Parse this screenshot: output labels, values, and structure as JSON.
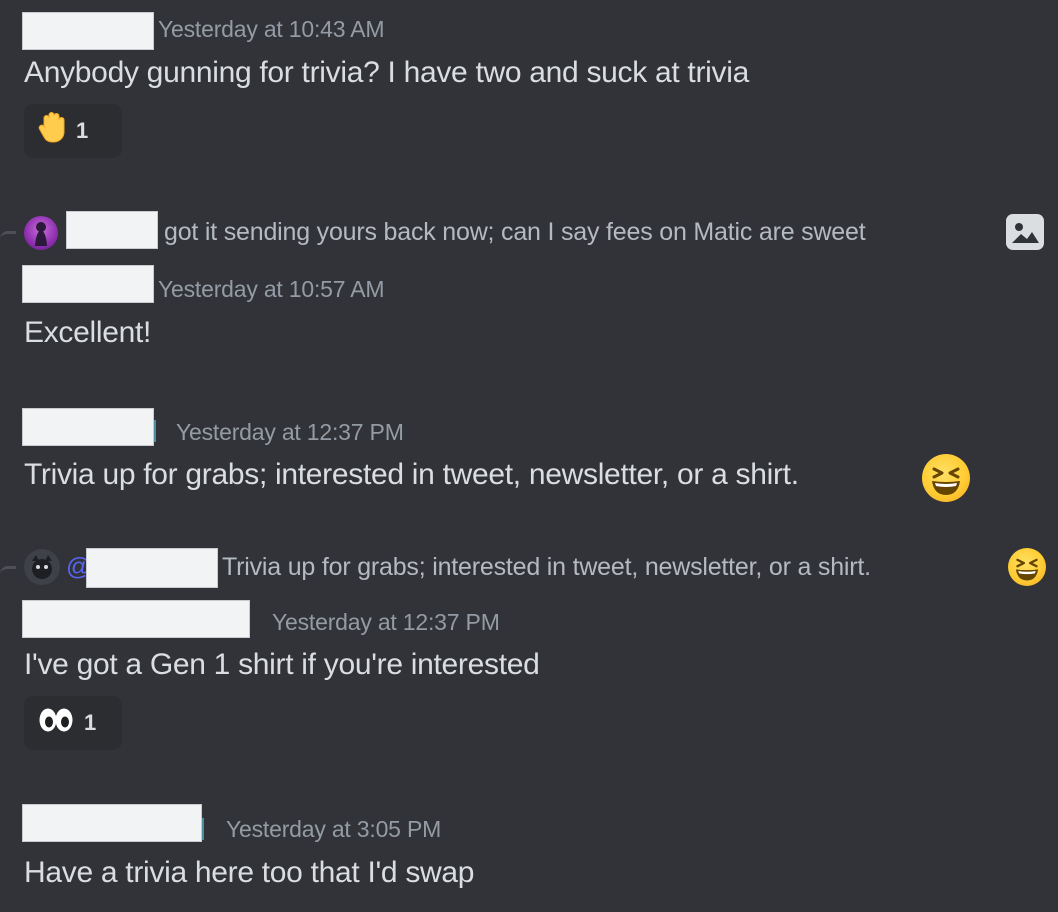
{
  "messages": [
    {
      "timestamp": "Yesterday at 10:43 AM",
      "text": "Anybody gunning for trivia? I have two and suck at trivia",
      "reaction": {
        "emoji": "raised-hand",
        "count": "1"
      }
    },
    {
      "reply_preview": "got it sending yours back now; can I say fees on Matic are sweet",
      "timestamp": "Yesterday at 10:57 AM",
      "text": "Excellent!"
    },
    {
      "timestamp": "Yesterday at 12:37 PM",
      "text": "Trivia up for grabs; interested in tweet, newsletter, or a shirt."
    },
    {
      "reply_mention": "@",
      "reply_preview": "Trivia up for grabs; interested in tweet, newsletter, or a shirt.",
      "timestamp": "Yesterday at 12:37 PM",
      "text": "I've got a Gen 1 shirt if you're interested",
      "reaction": {
        "emoji": "eyes",
        "count": "1"
      }
    },
    {
      "timestamp": "Yesterday at 3:05 PM",
      "text": "Have a trivia here too that I'd swap"
    }
  ],
  "colors": {
    "background": "#313338",
    "text": "#dbdee1",
    "timestamp": "#949ba4",
    "reaction_bg": "#2b2d31"
  }
}
